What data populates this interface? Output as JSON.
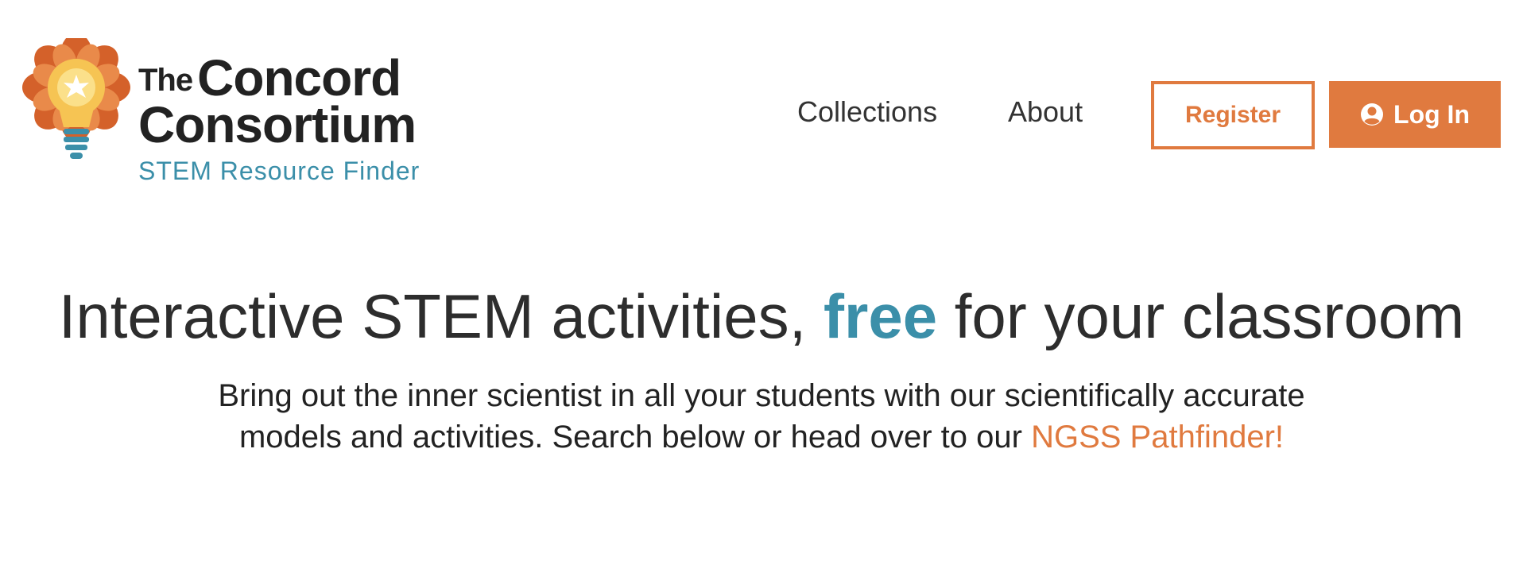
{
  "brand": {
    "name_small": "The",
    "name_line1": "Concord",
    "name_line2": "Consortium",
    "subtitle": "STEM Resource Finder",
    "colors": {
      "orange": "#e07a3f",
      "teal": "#3b8fa9",
      "dark": "#222222",
      "bulb_yellow": "#f6c453"
    },
    "logo_icon": "lightbulb-flower-icon"
  },
  "nav": {
    "collections": "Collections",
    "about": "About"
  },
  "auth": {
    "register": "Register",
    "login": "Log In",
    "login_icon": "user-circle-icon"
  },
  "hero": {
    "title_part1": "Interactive STEM activities,",
    "title_accent": "free",
    "title_part2": "for your classroom",
    "desc_text": "Bring out the inner scientist in all your students with our scientifically accurate models and activities. Search below or head over to our",
    "desc_link": "NGSS Pathfinder!"
  }
}
